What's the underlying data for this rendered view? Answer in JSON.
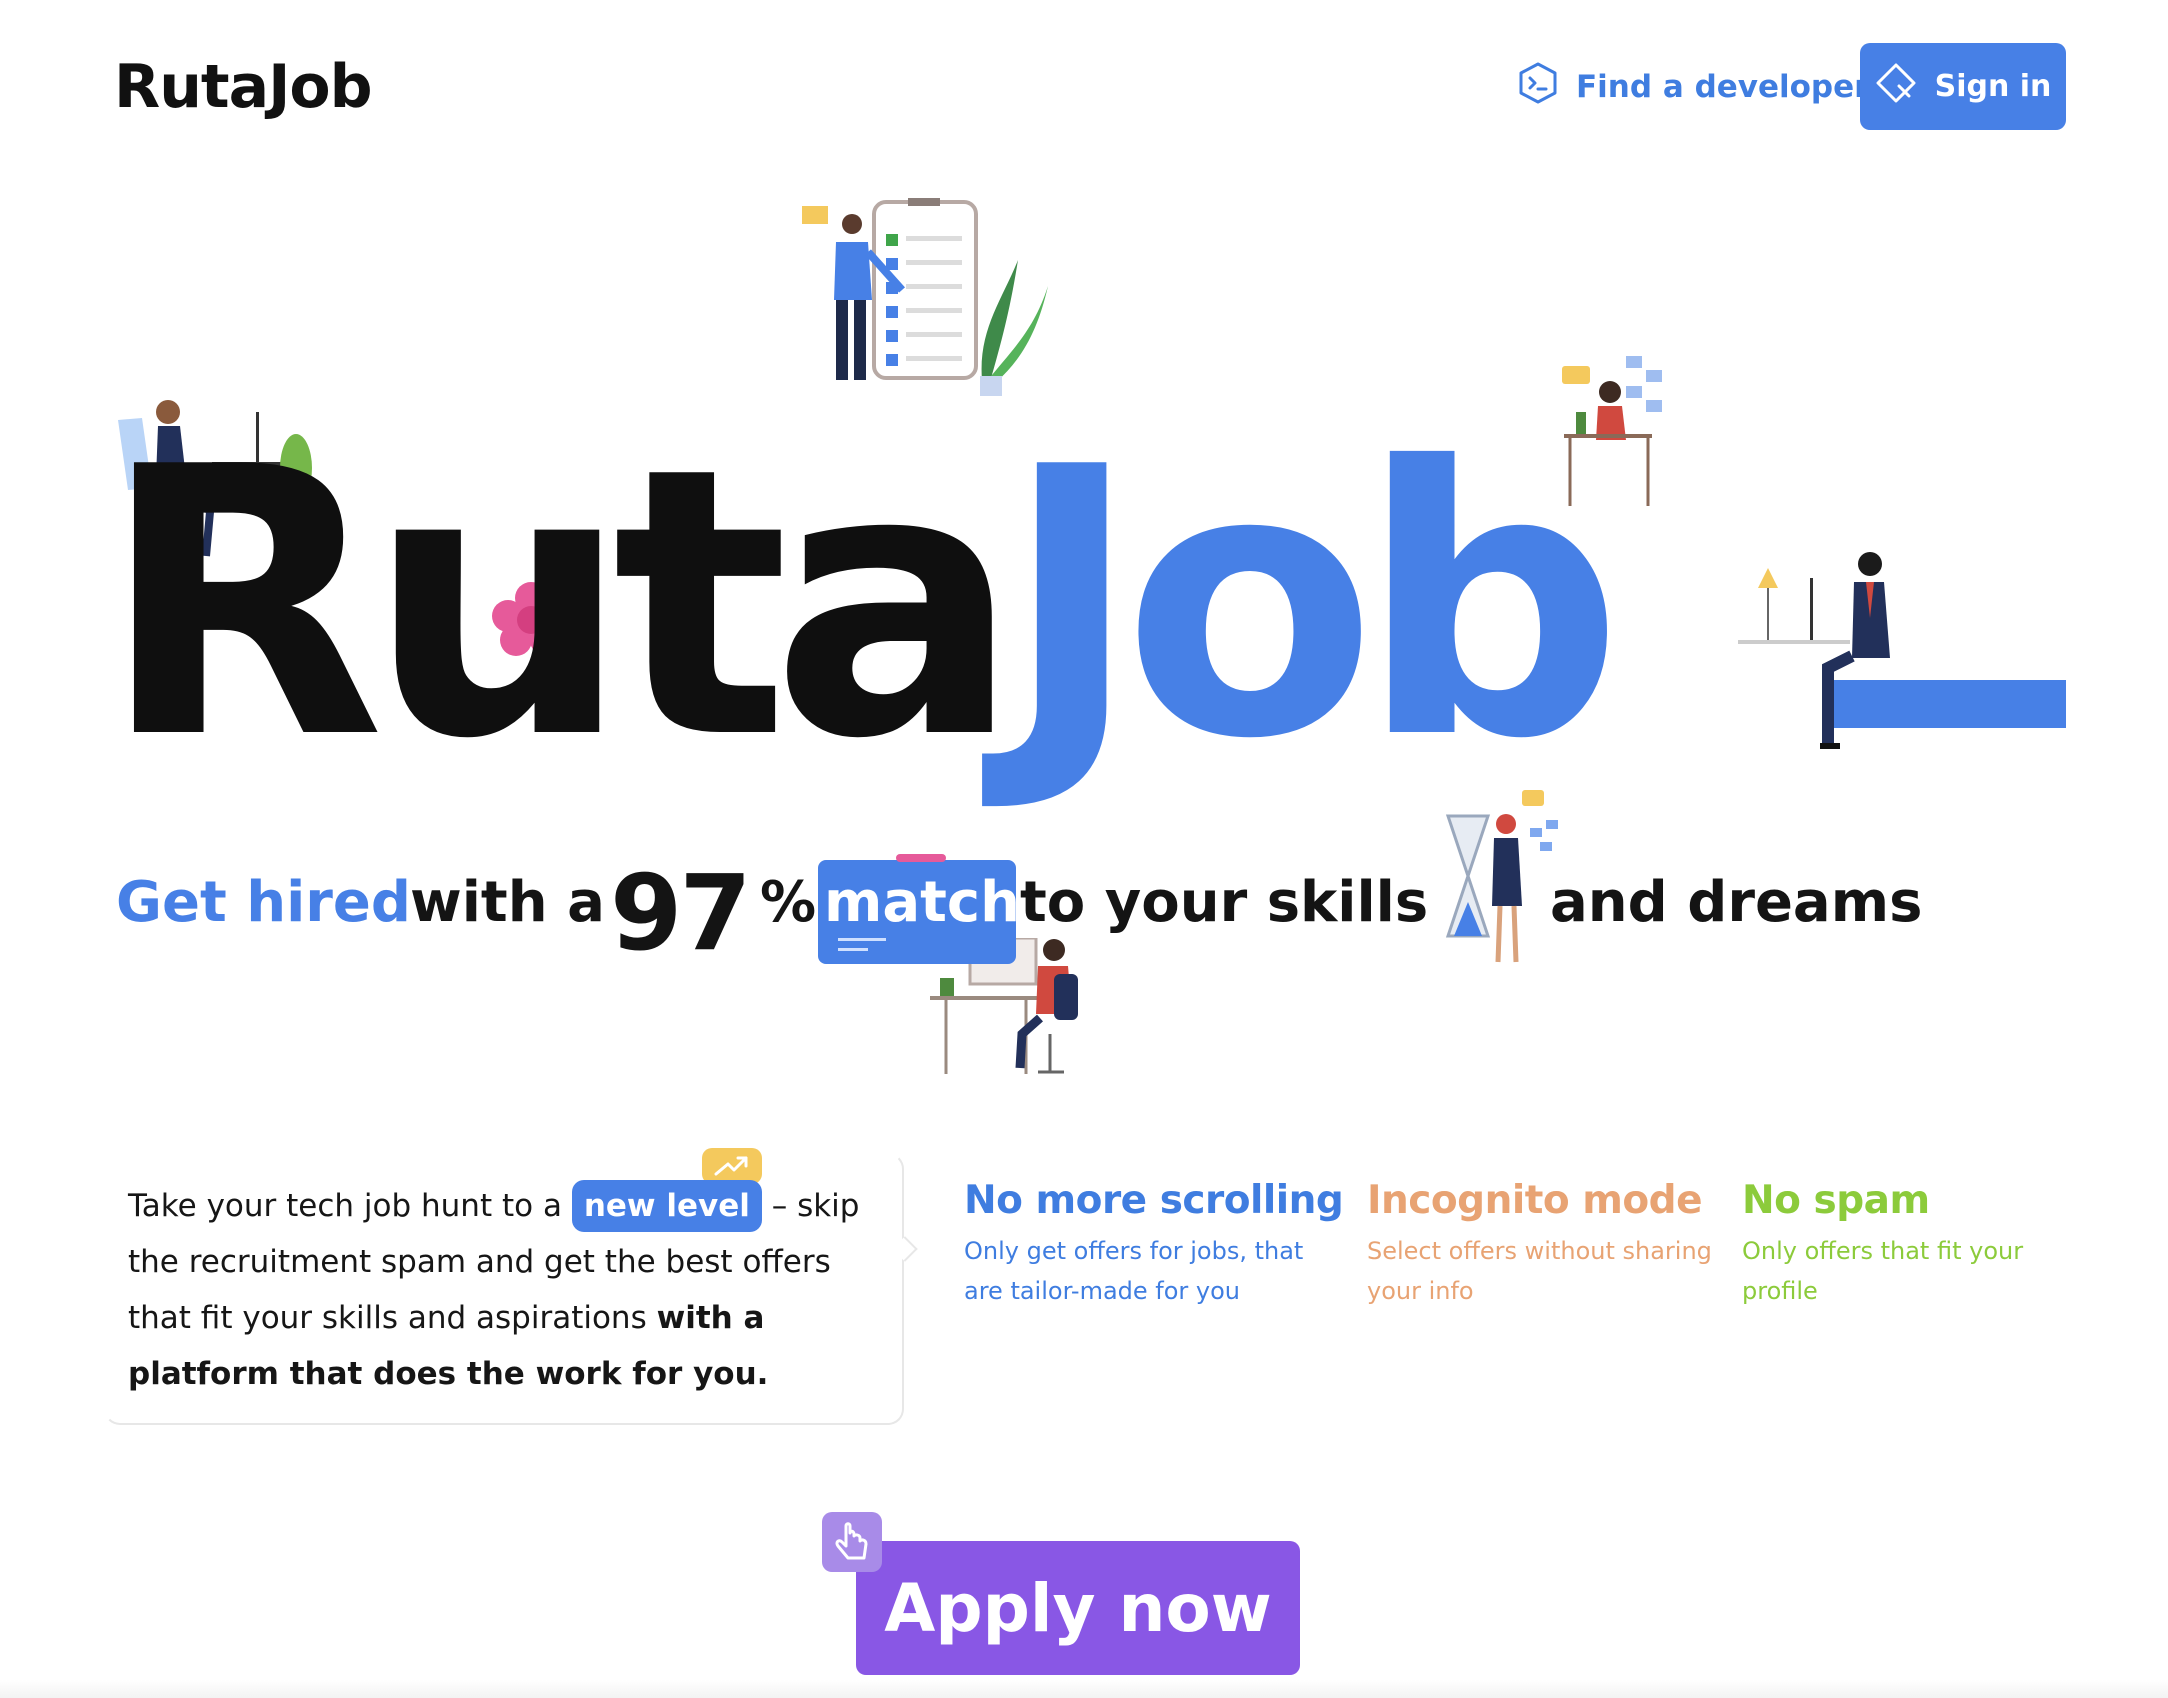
{
  "header": {
    "logo": "RutaJob",
    "find_developer": "Find a developer",
    "sign_in": "Sign in"
  },
  "hero": {
    "ruta": "Ruta",
    "job": "Job"
  },
  "tagline": {
    "get_hired": "Get hired",
    "with_a": "with a",
    "percent_value": "97",
    "percent_sign": "%",
    "match": "match",
    "to_your_skills": "to your skills",
    "and_dreams": "and dreams"
  },
  "description": {
    "part1": "Take your tech job hunt to a",
    "highlight": "new level",
    "part2": " – skip the recruitment spam and get the best offers that fit your skills and aspirations ",
    "bold": "with a platform that does the work for you."
  },
  "features": [
    {
      "title": "No more scrolling",
      "text": "Only get offers for jobs, that are tailor-made for you"
    },
    {
      "title": "Incognito mode",
      "text": "Select offers without sharing your info"
    },
    {
      "title": "No spam",
      "text": "Only offers that fit your profile"
    }
  ],
  "cta": {
    "apply": "Apply now"
  },
  "icons": {
    "find_developer": "terminal-hexagon-icon",
    "sign_in": "diamond-cursor-icon",
    "new_level": "trend-up-icon",
    "apply": "pointer-hand-icon"
  },
  "colors": {
    "blue": "#4780e6",
    "purple": "#8957e5",
    "orange": "#e8a373",
    "green": "#8ccb3b",
    "pink": "#e65a9a"
  }
}
